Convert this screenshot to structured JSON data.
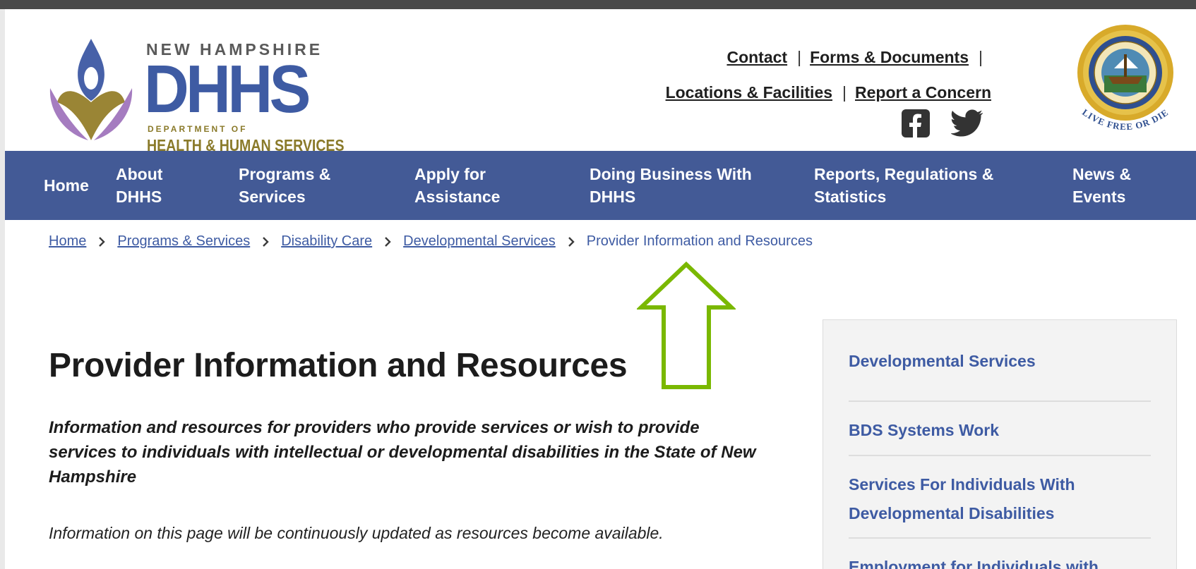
{
  "header": {
    "logo": {
      "state": "NEW HAMPSHIRE",
      "name": "DHHS",
      "dept": "DEPARTMENT OF",
      "full": "HEALTH & HUMAN SERVICES"
    },
    "utility_links": {
      "contact": "Contact",
      "forms": "Forms & Documents",
      "locations": "Locations & Facilities",
      "report": "Report a Concern",
      "separator": "|"
    },
    "social_icons": [
      "facebook-icon",
      "twitter-icon"
    ],
    "seal_motto": "LIVE FREE OR DIE"
  },
  "nav": {
    "home": "Home",
    "about": [
      "About",
      "DHHS"
    ],
    "programs": [
      "Programs &",
      "Services"
    ],
    "apply": [
      "Apply for",
      "Assistance"
    ],
    "business": [
      "Doing Business With",
      "DHHS"
    ],
    "reports": [
      "Reports, Regulations &",
      "Statistics"
    ],
    "news": [
      "News &",
      "Events"
    ]
  },
  "breadcrumb": {
    "items": [
      "Home",
      "Programs & Services",
      "Disability Care",
      "Developmental Services"
    ],
    "current": "Provider Information and Resources"
  },
  "main": {
    "title": "Provider Information and Resources",
    "lead": "Information and resources for providers who provide services or wish to provide services to individuals with intellectual or developmental disabilities in the State of New Hampshire",
    "note": "Information on this page will be continuously updated as resources become available."
  },
  "sidebar": {
    "items": [
      "Developmental Services",
      "BDS Systems Work",
      "Services For Individuals With Developmental Disabilities",
      "Employment for Individuals with"
    ]
  },
  "colors": {
    "brand_blue": "#435a96",
    "link_blue": "#3e5ba3",
    "gold": "#8a7a2a",
    "purple": "#a57cc0",
    "annotation_green": "#7ab800"
  }
}
